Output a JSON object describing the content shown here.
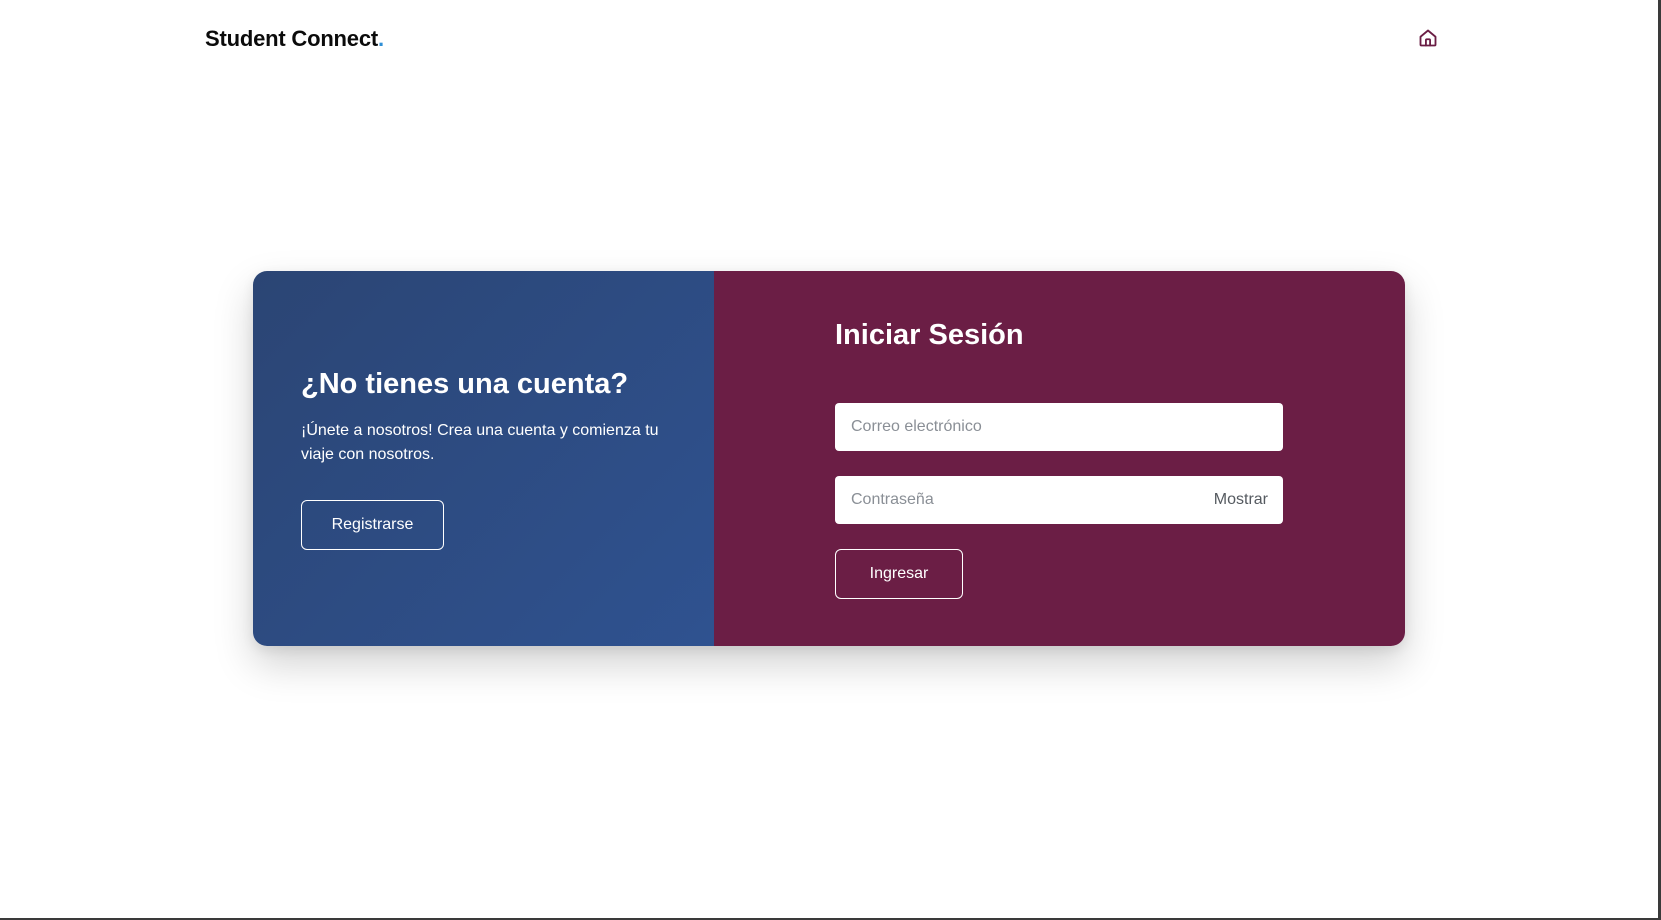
{
  "header": {
    "brand_text": "Student Connect",
    "brand_dot": ".",
    "home_icon": "home-icon",
    "accent_color": "#6b1e45",
    "dot_color": "#2f8fd6"
  },
  "register_panel": {
    "title": "¿No tienes una cuenta?",
    "text": "¡Únete a nosotros! Crea una cuenta y comienza tu viaje con nosotros.",
    "button_label": "Registrarse",
    "background_color": "#2f5290"
  },
  "login_panel": {
    "title": "Iniciar Sesión",
    "email_placeholder": "Correo electrónico",
    "email_value": "",
    "password_placeholder": "Contraseña",
    "password_value": "",
    "show_password_label": "Mostrar",
    "submit_label": "Ingresar",
    "background_color": "#6b1e45"
  }
}
